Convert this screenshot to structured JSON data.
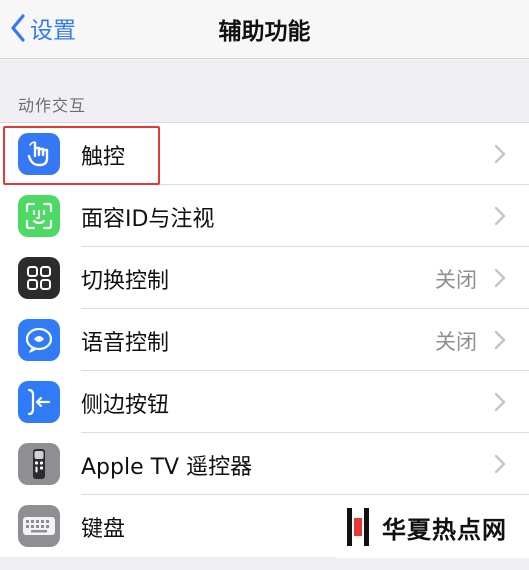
{
  "nav": {
    "back_label": "设置",
    "title": "辅助功能"
  },
  "section": {
    "header": "动作交互"
  },
  "rows": [
    {
      "label": "触控",
      "value": "",
      "icon": "touch-hand-icon",
      "color": "#3478f6"
    },
    {
      "label": "面容ID与注视",
      "value": "",
      "icon": "face-id-icon",
      "color": "#4cd964"
    },
    {
      "label": "切换控制",
      "value": "关闭",
      "icon": "switch-control-icon",
      "color": "#2c2c2e"
    },
    {
      "label": "语音控制",
      "value": "关闭",
      "icon": "voice-control-icon",
      "color": "#2f7cf6"
    },
    {
      "label": "侧边按钮",
      "value": "",
      "icon": "side-button-icon",
      "color": "#2f7cf6"
    },
    {
      "label": "Apple TV 遥控器",
      "value": "",
      "icon": "tv-remote-icon",
      "color": "#8e8e93"
    },
    {
      "label": "键盘",
      "value": "",
      "icon": "keyboard-icon",
      "color": "#8e8e93"
    }
  ],
  "watermark": {
    "text": "华夏热点网"
  },
  "colors": {
    "accent": "#3478f6",
    "highlight": "#e53935"
  }
}
